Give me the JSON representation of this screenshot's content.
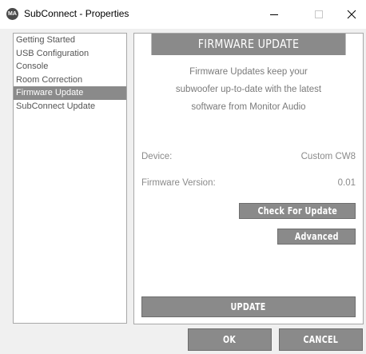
{
  "window": {
    "title": "SubConnect - Properties",
    "icon_label": "MA",
    "controls": [
      "minimize-icon",
      "maximize-icon",
      "close-icon"
    ]
  },
  "sidebar": {
    "items": [
      {
        "label": "Getting Started",
        "selected": false
      },
      {
        "label": "USB Configuration",
        "selected": false
      },
      {
        "label": "Console",
        "selected": false
      },
      {
        "label": "Room Correction",
        "selected": false
      },
      {
        "label": "Firmware Update",
        "selected": true
      },
      {
        "label": "SubConnect Update",
        "selected": false
      }
    ]
  },
  "panel": {
    "header": "FIRMWARE UPDATE",
    "description_lines": [
      "Firmware Updates keep your",
      "subwoofer up-to-date with the latest",
      "software from Monitor Audio"
    ],
    "device_label": "Device:",
    "device_value": "Custom CW8",
    "firmware_label": "Firmware Version:",
    "firmware_value": "0.01",
    "check_button": "Check For Update",
    "advanced_button": "Advanced",
    "update_button": "UPDATE"
  },
  "footer": {
    "ok_button": "OK",
    "cancel_button": "CANCEL"
  },
  "colors": {
    "accent_gray": "#8a8a8a",
    "panel_bg": "#ffffff",
    "window_bg": "#f0f0f0"
  }
}
